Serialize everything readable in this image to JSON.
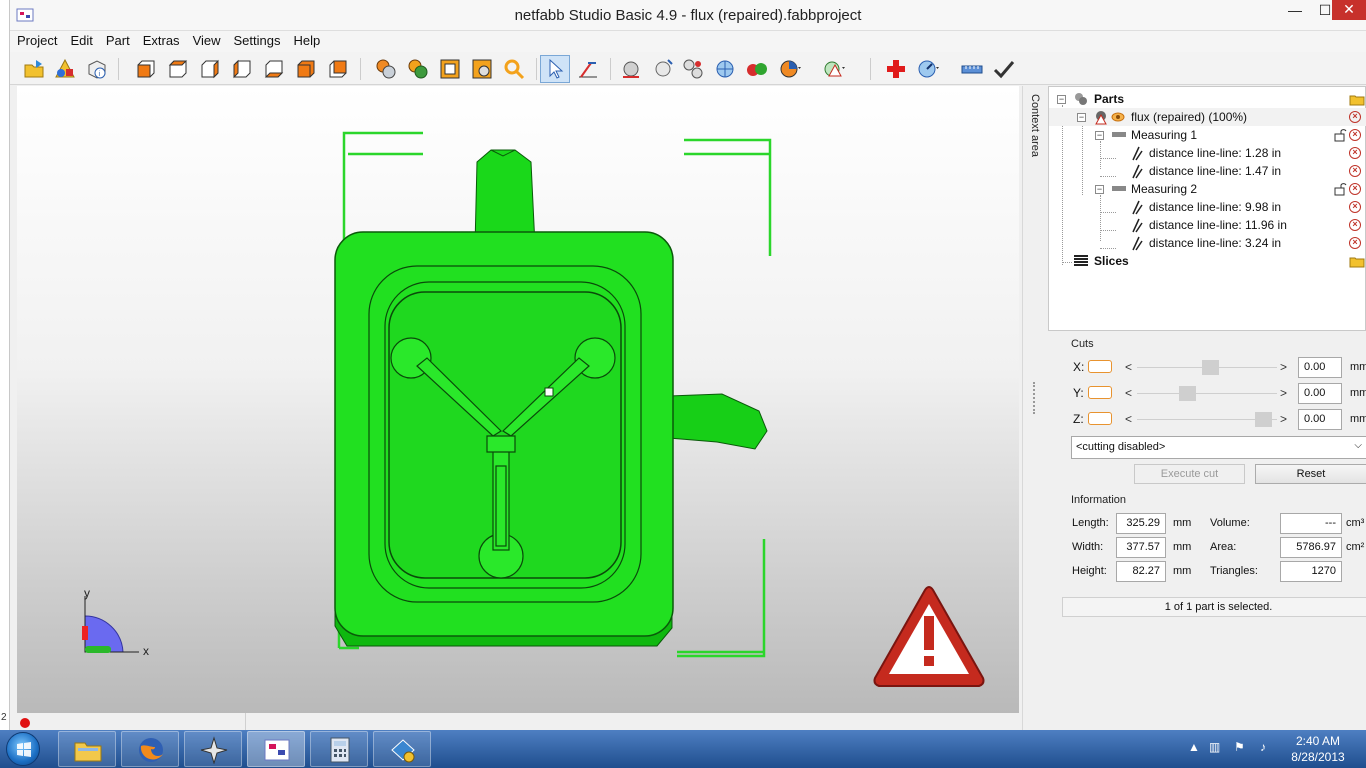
{
  "window": {
    "title": "netfabb Studio Basic 4.9 - flux (repaired).fabbproject",
    "minimize_glyph": "—",
    "maximize_glyph": "☐",
    "close_glyph": "✕",
    "colors": {
      "titlebar": "#f7f7f7",
      "close": "#c7312b"
    }
  },
  "menu": {
    "items": [
      "Project",
      "Edit",
      "Part",
      "Extras",
      "View",
      "Settings",
      "Help"
    ]
  },
  "toolbar": {
    "icons": [
      "open-project-icon",
      "add-part-icon",
      "part-info-icon",
      "view-front-icon",
      "view-back-icon",
      "view-left-icon",
      "view-right-icon",
      "view-top-icon",
      "view-bottom-icon",
      "view-perspective-icon",
      "shading-icon",
      "textured-icon",
      "wireframe-icon",
      "view-camera-icon",
      "zoom-icon",
      "select-arrow-icon",
      "measure-icon",
      "sphere-icon",
      "sphere-light-icon",
      "spheres-group-icon",
      "spheres-blue-icon",
      "spheres-red-icon",
      "pie-menu-icon",
      "warning-dropdown-icon",
      "repair-cross-icon",
      "dial-dropdown-icon",
      "ruler-icon",
      "apply-check-icon"
    ]
  },
  "viewport": {
    "axis_x": "x",
    "axis_y": "y",
    "model_color": "#21e020",
    "warning_color": "#c52a1e"
  },
  "context_area": {
    "label": "Context area"
  },
  "tree": {
    "parts_label": "Parts",
    "part_label": "flux (repaired) (100%)",
    "measuring1": "Measuring 1",
    "m1_items": [
      "distance line-line: 1.28 in",
      "distance line-line: 1.47 in"
    ],
    "measuring2": "Measuring 2",
    "m2_items": [
      "distance line-line: 9.98 in",
      "distance line-line: 11.96 in",
      "distance line-line: 3.24 in"
    ],
    "slices_label": "Slices"
  },
  "cuts": {
    "title": "Cuts",
    "x_label": "X:",
    "y_label": "Y:",
    "z_label": "Z:",
    "x_value": "0.00",
    "y_value": "0.00",
    "z_value": "0.00",
    "unit": "mm",
    "x_pos": 0.53,
    "y_pos": 0.34,
    "z_pos": 0.96,
    "mode": "<cutting disabled>",
    "execute_label": "Execute cut",
    "reset_label": "Reset"
  },
  "information": {
    "title": "Information",
    "length_label": "Length:",
    "length_value": "325.29",
    "width_label": "Width:",
    "width_value": "377.57",
    "height_label": "Height:",
    "height_value": "82.27",
    "dim_unit": "mm",
    "volume_label": "Volume:",
    "volume_value": "---",
    "volume_unit": "cm³",
    "area_label": "Area:",
    "area_value": "5786.97",
    "area_unit": "cm²",
    "triangles_label": "Triangles:",
    "triangles_value": "1270"
  },
  "status": {
    "selection": "1 of 1 part is selected.",
    "left_tick": "2"
  },
  "taskbar": {
    "apps": [
      "explorer-icon",
      "firefox-icon",
      "ninja-star-icon",
      "netfabb-icon",
      "calculator-icon",
      "fabb-tool-icon"
    ],
    "time": "2:40 AM",
    "date": "8/28/2013"
  }
}
